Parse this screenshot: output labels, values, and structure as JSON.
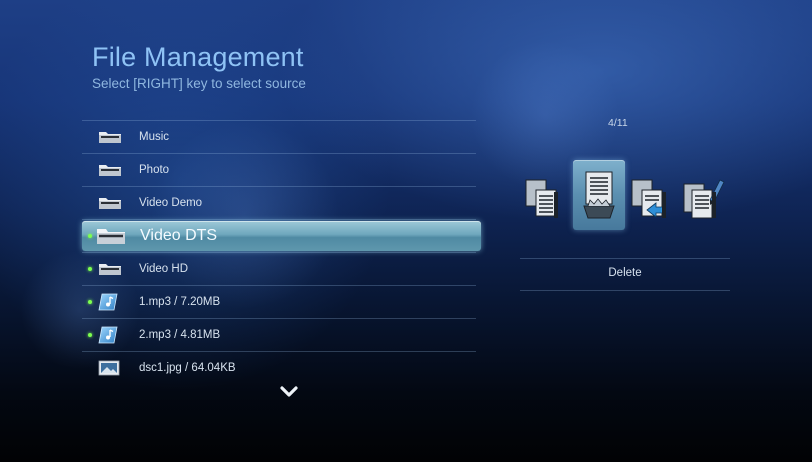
{
  "header": {
    "title": "File Management",
    "subtitle": "Select [RIGHT] key to select source"
  },
  "list": {
    "items": [
      {
        "label": "Music",
        "icon": "folder-icon",
        "marked": false,
        "selected": false
      },
      {
        "label": "Photo",
        "icon": "folder-icon",
        "marked": false,
        "selected": false
      },
      {
        "label": "Video Demo",
        "icon": "folder-icon",
        "marked": false,
        "selected": false
      },
      {
        "label": "Video DTS",
        "icon": "folder-icon",
        "marked": true,
        "selected": true
      },
      {
        "label": "Video HD",
        "icon": "folder-icon",
        "marked": true,
        "selected": false
      },
      {
        "label": "1.mp3 / 7.20MB",
        "icon": "audio-file-icon",
        "marked": true,
        "selected": false
      },
      {
        "label": "2.mp3 / 4.81MB",
        "icon": "audio-file-icon",
        "marked": true,
        "selected": false
      },
      {
        "label": "dsc1.jpg / 64.04KB",
        "icon": "image-file-icon",
        "marked": false,
        "selected": false
      }
    ],
    "more_icon": "chevron-down-icon"
  },
  "panel": {
    "counter": "4/11",
    "actions": [
      {
        "icon": "copy-icon",
        "selected": false
      },
      {
        "icon": "delete-icon",
        "selected": true
      },
      {
        "icon": "move-icon",
        "selected": false
      },
      {
        "icon": "rename-icon",
        "selected": false
      }
    ],
    "action_label": "Delete"
  },
  "colors": {
    "marker": "#7dff4f",
    "title": "#8fc3f5",
    "highlight": "#6ea7bd"
  }
}
